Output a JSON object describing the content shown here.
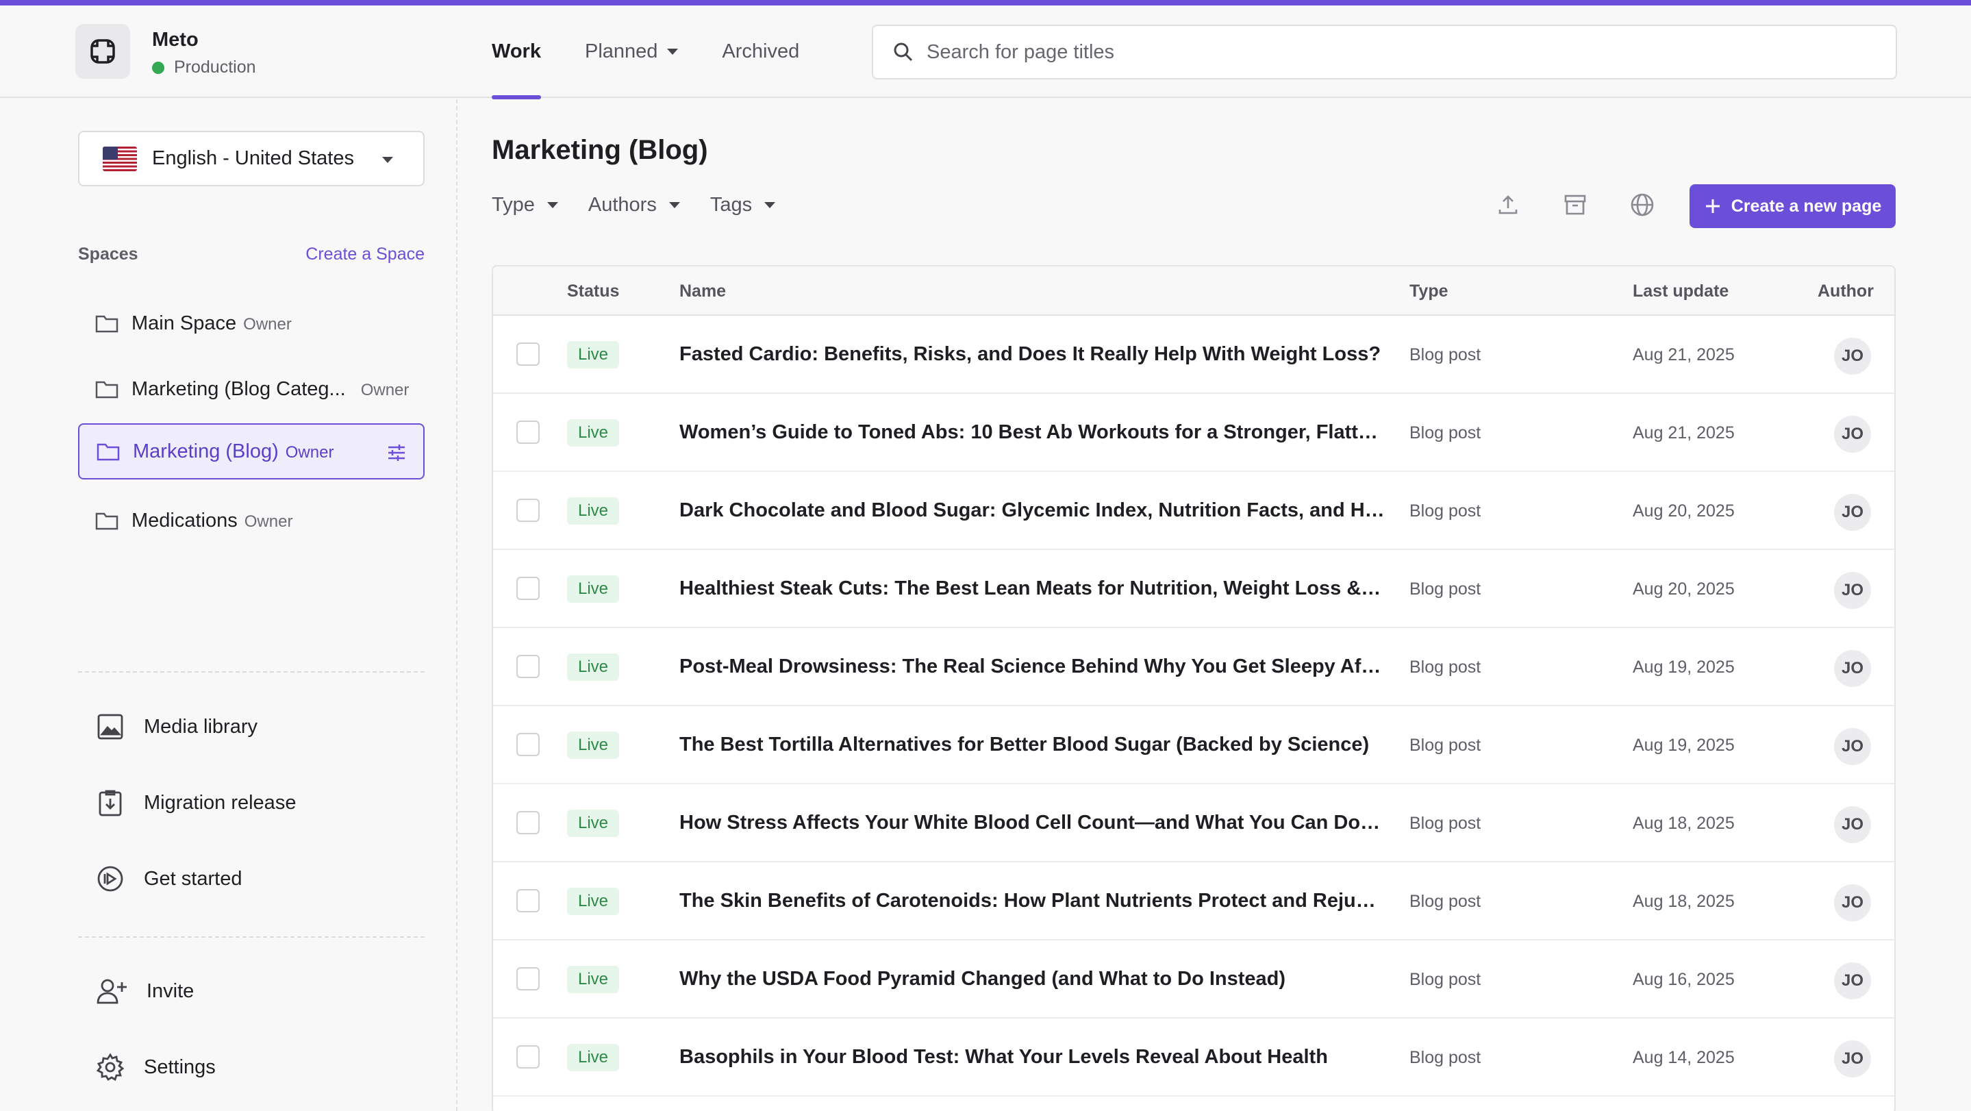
{
  "app": {
    "name": "Meto",
    "environment": "Production",
    "environment_color": "#34a853",
    "accent": "#6b4fd8"
  },
  "tabs": [
    {
      "label": "Work",
      "active": true
    },
    {
      "label": "Planned",
      "dropdown": true
    },
    {
      "label": "Archived"
    }
  ],
  "search": {
    "placeholder": "Search for page titles",
    "value": ""
  },
  "sidebar": {
    "language": {
      "selected": "English - United States",
      "icon": "us-flag-icon"
    },
    "spaces_title": "Spaces",
    "create_space": "Create a Space",
    "spaces": [
      {
        "name": "Main Space",
        "role": "Owner"
      },
      {
        "name": "Marketing (Blog Categ...",
        "role": "Owner"
      },
      {
        "name": "Marketing (Blog)",
        "role": "Owner",
        "active": true
      },
      {
        "name": "Medications",
        "role": "Owner"
      }
    ],
    "nav": [
      {
        "label": "Media library",
        "icon": "image-icon"
      },
      {
        "label": "Migration release",
        "icon": "download-clipboard-icon"
      },
      {
        "label": "Get started",
        "icon": "play-circle-icon"
      }
    ],
    "bottom": [
      {
        "label": "Invite",
        "icon": "user-plus-icon"
      },
      {
        "label": "Settings",
        "icon": "gear-icon"
      }
    ]
  },
  "main": {
    "title": "Marketing (Blog)",
    "filters": [
      "Type",
      "Authors",
      "Tags"
    ],
    "create_label": "Create a new page",
    "columns": {
      "status": "Status",
      "name": "Name",
      "type": "Type",
      "last_update": "Last update",
      "author": "Author"
    },
    "rows": [
      {
        "status": "Live",
        "name": "Fasted Cardio: Benefits, Risks, and Does It Really Help With Weight Loss?",
        "type": "Blog post",
        "date": "Aug 21, 2025",
        "author": "JO"
      },
      {
        "status": "Live",
        "name": "Women’s Guide to Toned Abs: 10 Best Ab Workouts for a Stronger, Flatter ...",
        "type": "Blog post",
        "date": "Aug 21, 2025",
        "author": "JO"
      },
      {
        "status": "Live",
        "name": "Dark Chocolate and Blood Sugar: Glycemic Index, Nutrition Facts, and Heal...",
        "type": "Blog post",
        "date": "Aug 20, 2025",
        "author": "JO"
      },
      {
        "status": "Live",
        "name": "Healthiest Steak Cuts: The Best Lean Meats for Nutrition, Weight Loss & Lo...",
        "type": "Blog post",
        "date": "Aug 20, 2025",
        "author": "JO"
      },
      {
        "status": "Live",
        "name": "Post-Meal Drowsiness: The Real Science Behind Why You Get Sleepy After ...",
        "type": "Blog post",
        "date": "Aug 19, 2025",
        "author": "JO"
      },
      {
        "status": "Live",
        "name": "The Best Tortilla Alternatives for Better Blood Sugar (Backed by Science)",
        "type": "Blog post",
        "date": "Aug 19, 2025",
        "author": "JO"
      },
      {
        "status": "Live",
        "name": "How Stress Affects Your White Blood Cell Count—and What You Can Do Ab...",
        "type": "Blog post",
        "date": "Aug 18, 2025",
        "author": "JO"
      },
      {
        "status": "Live",
        "name": "The Skin Benefits of Carotenoids: How Plant Nutrients Protect and Rejuven...",
        "type": "Blog post",
        "date": "Aug 18, 2025",
        "author": "JO"
      },
      {
        "status": "Live",
        "name": "Why the USDA Food Pyramid Changed (and What to Do Instead)",
        "type": "Blog post",
        "date": "Aug 16, 2025",
        "author": "JO"
      },
      {
        "status": "Live",
        "name": "Basophils in Your Blood Test: What Your Levels Reveal About Health",
        "type": "Blog post",
        "date": "Aug 14, 2025",
        "author": "JO"
      }
    ]
  }
}
